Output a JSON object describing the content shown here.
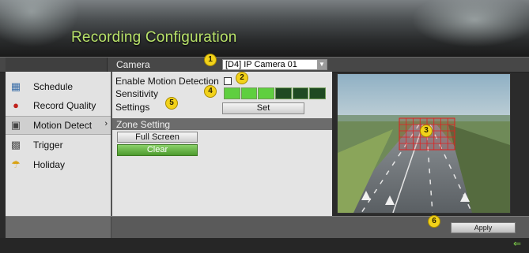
{
  "header": {
    "title": "Recording Configuration"
  },
  "camera_bar": {
    "label": "Camera",
    "selected_camera": "[D4] IP Camera 01"
  },
  "sidebar": {
    "items": [
      {
        "label": "Schedule",
        "icon": "schedule-icon",
        "active": false
      },
      {
        "label": "Record Quality",
        "icon": "record-icon",
        "active": false
      },
      {
        "label": "Motion Detect",
        "icon": "motion-icon",
        "active": true
      },
      {
        "label": "Trigger",
        "icon": "trigger-icon",
        "active": false
      },
      {
        "label": "Holiday",
        "icon": "holiday-icon",
        "active": false
      }
    ]
  },
  "main": {
    "enable_label": "Enable Motion Detection",
    "enable_checked": false,
    "sensitivity_label": "Sensitivity",
    "sensitivity_level": 3,
    "sensitivity_max": 6,
    "settings_label": "Settings",
    "set_button": "Set",
    "zone_setting_label": "Zone Setting",
    "full_screen_button": "Full Screen",
    "clear_button": "Clear"
  },
  "callouts": [
    "1",
    "2",
    "3",
    "4",
    "5",
    "6"
  ],
  "bottom": {
    "apply_button": "Apply"
  },
  "colors": {
    "title": "#b9e36a",
    "sensitivity_on": "#5fcf3f",
    "sensitivity_off": "#1f4a22",
    "clear_button": "#5fae3a",
    "zone_grid": "#e02020",
    "callout": "#f2d21a"
  }
}
